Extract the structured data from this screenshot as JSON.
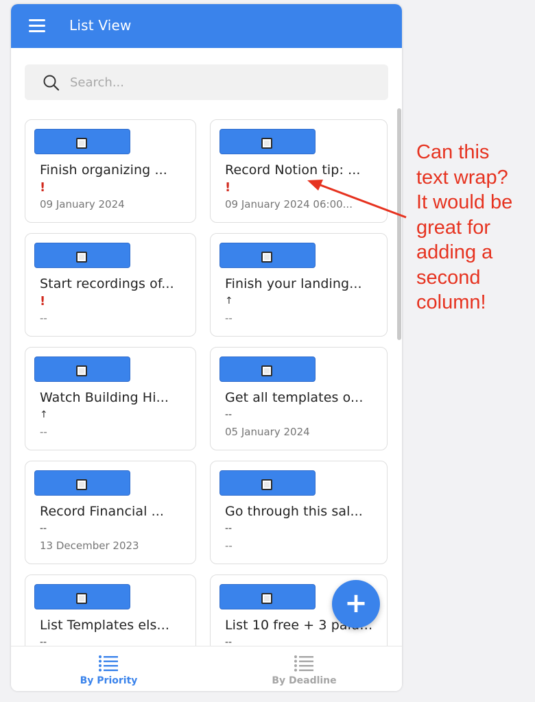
{
  "app": {
    "title": "List View"
  },
  "search": {
    "placeholder": "Search..."
  },
  "cards": [
    {
      "title": "Finish organizing ...",
      "priority": "!",
      "priority_level": "high",
      "date": "09 January 2024"
    },
    {
      "title": "Record Notion tip: ...",
      "priority": "!",
      "priority_level": "high",
      "date": "09 January 2024 06:00..."
    },
    {
      "title": "Start recordings of...",
      "priority": "!",
      "priority_level": "high",
      "date": "--"
    },
    {
      "title": "Finish your landing...",
      "priority": "↑",
      "priority_level": "up",
      "date": "--"
    },
    {
      "title": "Watch Building Hi...",
      "priority": "↑",
      "priority_level": "up",
      "date": "--"
    },
    {
      "title": "Get all templates o...",
      "priority": "--",
      "priority_level": "none",
      "date": "05 January 2024"
    },
    {
      "title": "Record Financial ...",
      "priority": "--",
      "priority_level": "none",
      "date": "13 December 2023"
    },
    {
      "title": "Go through this sal...",
      "priority": "--",
      "priority_level": "none",
      "date": "--"
    },
    {
      "title": "List Templates els...",
      "priority": "--",
      "priority_level": "none",
      "date": ""
    },
    {
      "title": "List 10 free + 3 paid ...",
      "priority": "--",
      "priority_level": "none",
      "date": ""
    }
  ],
  "fab": {
    "label": "+"
  },
  "bottom_nav": {
    "items": [
      {
        "label": "By Priority",
        "active": true
      },
      {
        "label": "By Deadline",
        "active": false
      }
    ]
  },
  "annotation": {
    "text_lines": [
      "Can this",
      "text wrap?",
      "It would be",
      "great for",
      "adding a",
      "second",
      "column!"
    ]
  },
  "colors": {
    "primary": "#3a83eb",
    "priority_high": "#d12a1e",
    "annotation": "#e6321f",
    "inactive_nav": "#a5a5a5"
  },
  "icons": {
    "menu": "menu-icon",
    "search": "search-icon",
    "checkbox": "checkbox-icon",
    "list": "list-icon",
    "add": "plus-icon"
  }
}
